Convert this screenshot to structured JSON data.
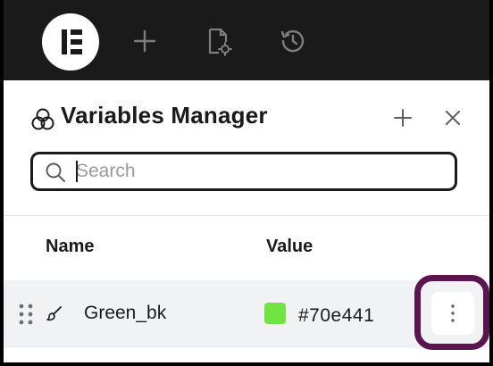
{
  "topbar": {
    "logo_icon": "elementor-logo-icon",
    "add_icon": "plus-icon",
    "page_settings_icon": "page-settings-icon",
    "history_icon": "history-icon"
  },
  "panel": {
    "title": "Variables Manager",
    "title_icon": "variables-icon",
    "add_icon": "plus-icon",
    "close_icon": "close-icon"
  },
  "search": {
    "placeholder": "Search",
    "value": ""
  },
  "table": {
    "columns": [
      "Name",
      "Value"
    ],
    "rows": [
      {
        "name": "Green_bk",
        "value": "#70e441",
        "swatch_color": "#70e441",
        "type_icon": "brush-icon"
      }
    ]
  },
  "colors": {
    "highlight": "#5a1450",
    "topbar_bg": "#1a1a1b"
  }
}
